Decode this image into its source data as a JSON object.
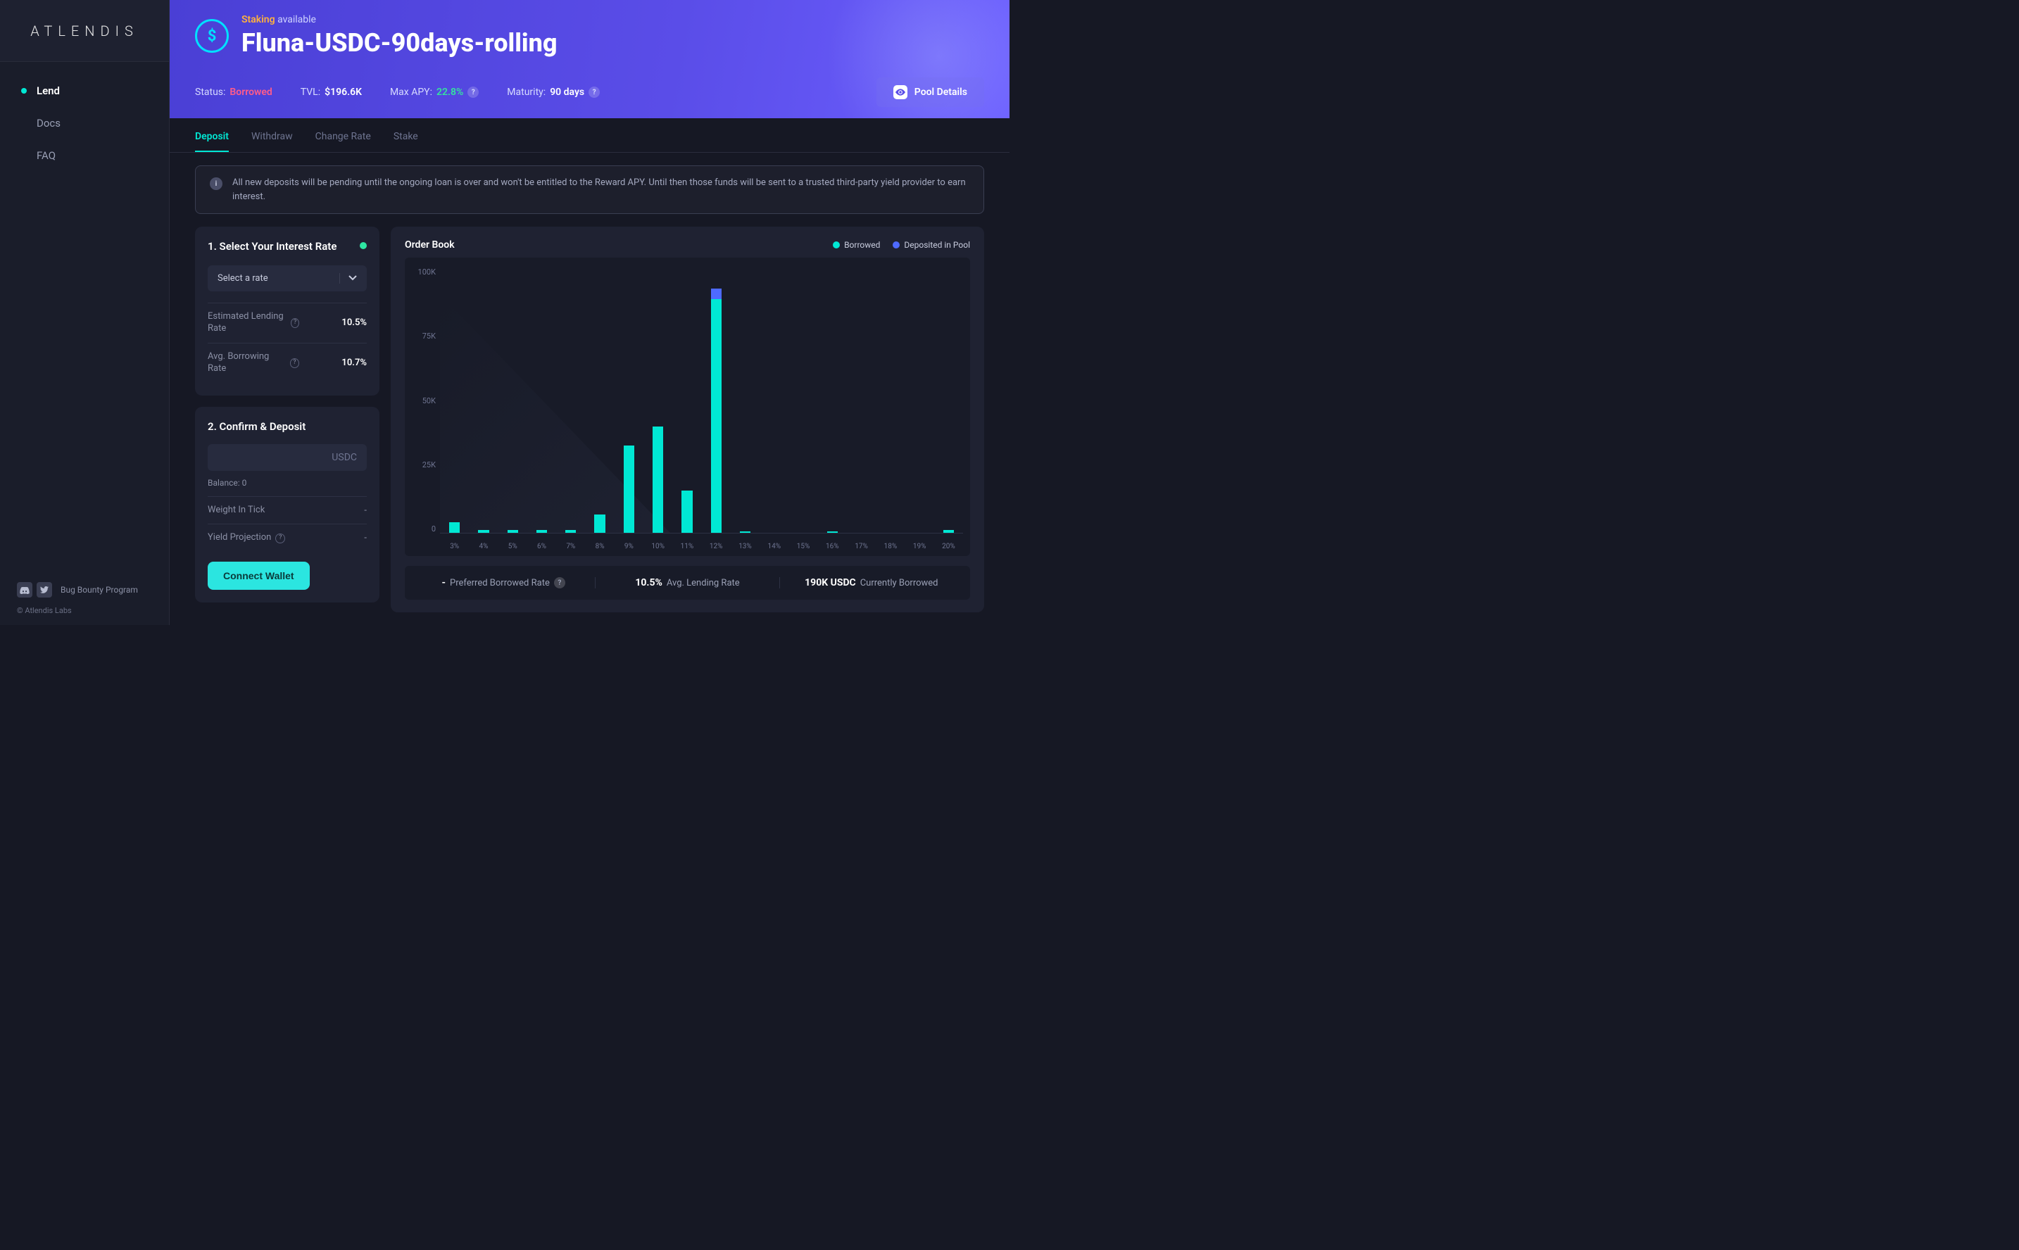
{
  "brand": "ATLENDIS",
  "sidebar": {
    "items": [
      {
        "label": "Lend",
        "active": true
      },
      {
        "label": "Docs",
        "active": false
      },
      {
        "label": "FAQ",
        "active": false
      }
    ],
    "bounty": "Bug Bounty Program",
    "copyright": "© Atlendis Labs"
  },
  "header": {
    "staking_word": "Staking",
    "available_word": "available",
    "pool_title": "Fluna-USDC-90days-rolling",
    "status_label": "Status:",
    "status_value": "Borrowed",
    "tvl_label": "TVL:",
    "tvl_value": "$196.6K",
    "apy_label": "Max APY:",
    "apy_value": "22.8%",
    "maturity_label": "Maturity:",
    "maturity_value": "90 days",
    "details_btn": "Pool Details"
  },
  "tabs": [
    "Deposit",
    "Withdraw",
    "Change Rate",
    "Stake"
  ],
  "notice": "All new deposits will be pending until the ongoing loan is over and won't be entitled to the Reward APY. Until then those funds will be sent to a trusted third-party yield provider to earn interest.",
  "step1": {
    "title": "1. Select Your Interest Rate",
    "select_placeholder": "Select a rate",
    "est_label": "Estimated Lending Rate",
    "est_value": "10.5%",
    "avg_label": "Avg. Borrowing Rate",
    "avg_value": "10.7%"
  },
  "step2": {
    "title": "2. Confirm & Deposit",
    "currency": "USDC",
    "balance_label": "Balance: 0",
    "weight_label": "Weight In Tick",
    "weight_value": "-",
    "yield_label": "Yield Projection",
    "yield_value": "-",
    "connect_btn": "Connect Wallet"
  },
  "chart": {
    "title": "Order Book",
    "legend_borrowed": "Borrowed",
    "legend_deposited": "Deposited in Pool",
    "footer_pref_value": "-",
    "footer_pref_label": "Preferred Borrowed Rate",
    "footer_lend_value": "10.5%",
    "footer_lend_label": "Avg. Lending Rate",
    "footer_cur_value": "190K USDC",
    "footer_cur_label": "Currently Borrowed"
  },
  "chart_data": {
    "type": "bar",
    "categories": [
      "3%",
      "4%",
      "5%",
      "6%",
      "7%",
      "8%",
      "9%",
      "10%",
      "11%",
      "12%",
      "13%",
      "14%",
      "15%",
      "16%",
      "17%",
      "18%",
      "19%",
      "20%"
    ],
    "series": [
      {
        "name": "Deposited in Pool",
        "color": "#4e6aff",
        "values": [
          0,
          0,
          0,
          0,
          0,
          0,
          0,
          0,
          0,
          4000,
          0,
          0,
          0,
          0,
          0,
          0,
          0,
          0
        ]
      },
      {
        "name": "Borrowed",
        "color": "#00e8d4",
        "values": [
          4000,
          1000,
          1000,
          1000,
          1000,
          7000,
          33000,
          40000,
          16000,
          88000,
          500,
          0,
          0,
          500,
          0,
          0,
          0,
          1000
        ]
      }
    ],
    "y_ticks": [
      "100K",
      "75K",
      "50K",
      "25K",
      "0"
    ],
    "ylim": [
      0,
      100000
    ],
    "xlabel": "",
    "ylabel": ""
  }
}
